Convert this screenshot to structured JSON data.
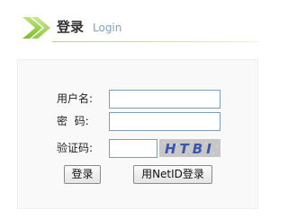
{
  "header": {
    "title": "登录",
    "subtitle": "Login"
  },
  "form": {
    "username_label": "用户名:",
    "password_label": "密  码:",
    "captcha_label": "验证码:",
    "username_value": "",
    "password_value": "",
    "captcha_value": "",
    "captcha_text": "HTBI"
  },
  "buttons": {
    "login": "登录",
    "netid_login": "用NetID登录"
  },
  "colors": {
    "arrow": "#8cc63f",
    "header_rule": "#c8e27a",
    "panel_bg": "#f9f9f9",
    "captcha_text": "#3a56b0"
  }
}
